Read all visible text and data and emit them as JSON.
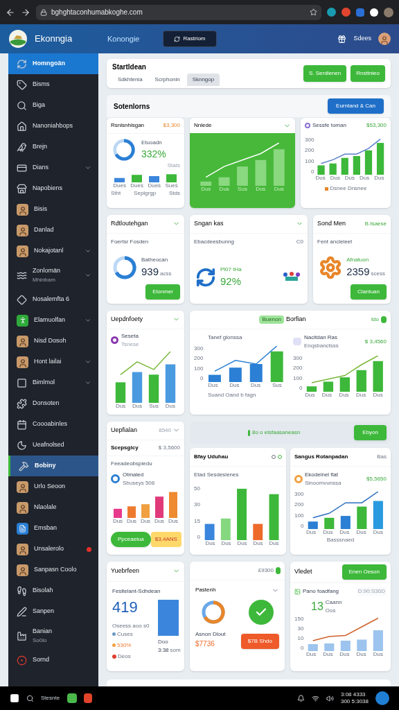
{
  "browser": {
    "url": "bghghtaconhumabkoghe.com"
  },
  "header": {
    "brand": "Ekonngia",
    "nav_link": "Konongie",
    "nav_button": "Rastriom",
    "user": "Sdees"
  },
  "sidebar": {
    "items": [
      {
        "label": "Homngoän",
        "selected": true,
        "submenu": false,
        "alert": false
      },
      {
        "label": "Bisms",
        "selected": false,
        "submenu": false,
        "alert": false
      },
      {
        "label": "Biga",
        "selected": false,
        "submenu": false,
        "alert": false
      },
      {
        "label": "Nanoniahbops",
        "selected": false,
        "submenu": false,
        "alert": false
      },
      {
        "label": "Brejn",
        "selected": false,
        "submenu": false,
        "alert": false
      },
      {
        "label": "Dians",
        "selected": false,
        "submenu": true,
        "alert": false
      },
      {
        "label": "Napobiens",
        "selected": false,
        "submenu": false,
        "alert": false
      },
      {
        "label": "Bisis",
        "selected": false,
        "submenu": false,
        "alert": false
      },
      {
        "label": "Danlad",
        "selected": false,
        "submenu": false,
        "alert": false
      },
      {
        "label": "Nokajotanl",
        "selected": false,
        "submenu": true,
        "alert": false
      },
      {
        "label": "Zonlomän",
        "sublabel": "Mhinbam",
        "selected": false,
        "submenu": true,
        "alert": false
      },
      {
        "label": "Nosalemfta 6",
        "selected": false,
        "submenu": false,
        "alert": false
      },
      {
        "label": "Elamuolfan",
        "selected": false,
        "submenu": true,
        "alert": false
      },
      {
        "label": "Nisd Dosoh",
        "selected": false,
        "submenu": false,
        "alert": false
      },
      {
        "label": "Hont lailai",
        "selected": false,
        "submenu": true,
        "alert": false
      },
      {
        "label": "Bimlmol",
        "selected": false,
        "submenu": true,
        "alert": false
      },
      {
        "label": "Donsoten",
        "selected": false,
        "submenu": false,
        "alert": false
      },
      {
        "label": "Coooabinles",
        "selected": false,
        "submenu": false,
        "alert": false
      },
      {
        "label": "Ueafnolsed",
        "selected": false,
        "submenu": false,
        "alert": false
      },
      {
        "label": "Bobiny",
        "selected": false,
        "highlighted": true,
        "submenu": false,
        "alert": false
      },
      {
        "label": "Urlo Seoon",
        "selected": false,
        "submenu": false,
        "alert": false
      },
      {
        "label": "Nlaolale",
        "selected": false,
        "submenu": false,
        "alert": false
      },
      {
        "label": "Emsban",
        "selected": false,
        "submenu": false,
        "alert": false
      },
      {
        "label": "Unsalerolo",
        "selected": false,
        "submenu": false,
        "alert": true
      },
      {
        "label": "Sanpasn Coolo",
        "selected": false,
        "submenu": false,
        "alert": false
      },
      {
        "label": "Bisolah",
        "selected": false,
        "submenu": false,
        "alert": false
      },
      {
        "label": "Sanpen",
        "selected": false,
        "submenu": false,
        "alert": false
      },
      {
        "label": "Banian",
        "sublabel": "So0lo",
        "selected": false,
        "submenu": false,
        "alert": false
      },
      {
        "label": "Sornd",
        "selected": false,
        "submenu": false,
        "alert": false
      }
    ]
  },
  "top_panel": {
    "title": "Startldean",
    "tabs": [
      {
        "label": "Sdkhtenia",
        "selected": false
      },
      {
        "label": "Scrphonin",
        "selected": false
      },
      {
        "label": "Sknngop",
        "selected": true
      }
    ],
    "buttons": [
      "S. Serdlenen",
      "Rnsttnieo"
    ]
  },
  "section": {
    "title": "Sotenlorns",
    "button": "Eurntand & Can"
  },
  "row1": [
    {
      "title": "Rsnlsnhisgan",
      "value": "$3,300",
      "label": "Etuoadn",
      "percent": "332%",
      "corner": "Stats",
      "xlabels": [
        "Dues",
        "Dues",
        "Dues",
        "Sues"
      ],
      "footer": [
        "Stht",
        "Seplgrgp",
        "Stds"
      ]
    },
    {
      "title": "Nnlede",
      "xlabels": [
        "Dus",
        "Dus",
        "Sus",
        "Dus",
        "Dus"
      ]
    },
    {
      "title": "Sessfe toman",
      "value": "$53,300",
      "yticks": [
        "300",
        "200",
        "100",
        "0"
      ],
      "xlabels": [
        "Dus",
        "Dus",
        "Dus",
        "Dus",
        "Dus"
      ],
      "legend": "Dsnee Dnsnee"
    }
  ],
  "row2": [
    {
      "title": "Rdtloutehgan",
      "subtitle": "Foertsr Fosden",
      "label": "Batheocan",
      "value": "939",
      "unit": "acss",
      "button": "Elonmer"
    },
    {
      "title": "Sngan kas",
      "subtitle": "Ebacdeesbunng",
      "corner": "C0",
      "label": "Pl07 tHa",
      "value": "92%"
    },
    {
      "title": "Sond Men",
      "badge": "B.tsaese",
      "subtitle": "Fent ancleleet",
      "label": "Afnatuon",
      "value": "2359",
      "unit": "scess",
      "button": "Clantuan"
    }
  ],
  "row3": {
    "left": {
      "title": "Uepdnfoety",
      "legend_title": "Seseta",
      "legend_sub": "Tsnese",
      "xlabels": [
        "Dus",
        "Dus",
        "Sus",
        "Dus"
      ]
    },
    "wide": {
      "pill": "Buenon",
      "title": "Borfian",
      "corner": "tdo",
      "left": {
        "title": "Tanef glonssa",
        "yticks": [
          "300",
          "200",
          "100",
          "0"
        ],
        "xlabels": [
          "Dus",
          "Dus",
          "Dus",
          "Sus"
        ],
        "legend": "Suand Oand b fagn"
      },
      "right": {
        "title": "Nacitdan Ras",
        "subtitle": "Enqsbanctsss",
        "value": "$ 3,4560",
        "yticks": [
          "300",
          "200",
          "100",
          "0"
        ],
        "xlabels": [
          "Dus",
          "Dus",
          "Dus",
          "Dus",
          "Dus"
        ]
      }
    }
  },
  "row4": {
    "left": {
      "title": "Uepfialan",
      "tag": "8540",
      "subtitle": "Scepsgicy",
      "value": "$ 3,5600",
      "caption": "Feeadeobspiedu",
      "legend_title": "Otmaled",
      "legend_sub": "Sbuseys 508",
      "xlabels": [
        "Dus",
        "Dus",
        "Dus",
        "Dus",
        "Dus"
      ],
      "buttons": [
        "Ppceaeiua",
        "$3,4ANS"
      ]
    },
    "strip": {
      "text": "8o o eisfaasaneasn",
      "button": "Ebyon"
    },
    "middle": {
      "title": "Bfay Uduhau",
      "caption": "Etad Sesdesienes",
      "yticks": [
        "50",
        "30",
        "15",
        "0"
      ],
      "xlabels": [
        "Dus",
        "Dus",
        "Dus",
        "Dus",
        "Dus"
      ]
    },
    "right": {
      "title": "Sangus Rotanpadan",
      "tag": "Bas",
      "legend_title": "Ekodeinel flat",
      "legend_sub": "Sinoomvunssa",
      "value": "$5,5650",
      "yticks": [
        "300",
        "200",
        "100",
        "0"
      ],
      "xlabels": [
        "Dus",
        "Dus",
        "Dus",
        "Dus",
        "Dus"
      ],
      "axis_title": "Basssnaed"
    }
  },
  "row5": [
    {
      "title": "Yuebrfeen",
      "subtitle": "Fesltelant-Sdhdean",
      "value": "419",
      "stats": [
        "Oseess aoo s0",
        "Cuses",
        "530%",
        "Deos"
      ],
      "bar_caption": "Doo",
      "bar_value": "3:38",
      "bar_unit": "som"
    },
    {
      "tag": "£9300",
      "title": "Pastenh",
      "label": "Asnon Dlout",
      "value": "$7736",
      "button": "$7B Shdo"
    },
    {
      "title": "Vledet",
      "button": "Enen Oeson",
      "subtitle": "Pano foadfang",
      "stamp": "D:90:S36D",
      "value": "13",
      "value_label": "Caann",
      "value_sub": "Oos",
      "yticks": [
        "150",
        "30",
        "10",
        "0"
      ],
      "xlabels": [
        "Dus",
        "Dus",
        "Dus",
        "Dus",
        "Dus"
      ]
    }
  ],
  "taskbar": {
    "search": "Stesnte",
    "clock": [
      "3:08 4333",
      "300 5:3038"
    ]
  }
}
